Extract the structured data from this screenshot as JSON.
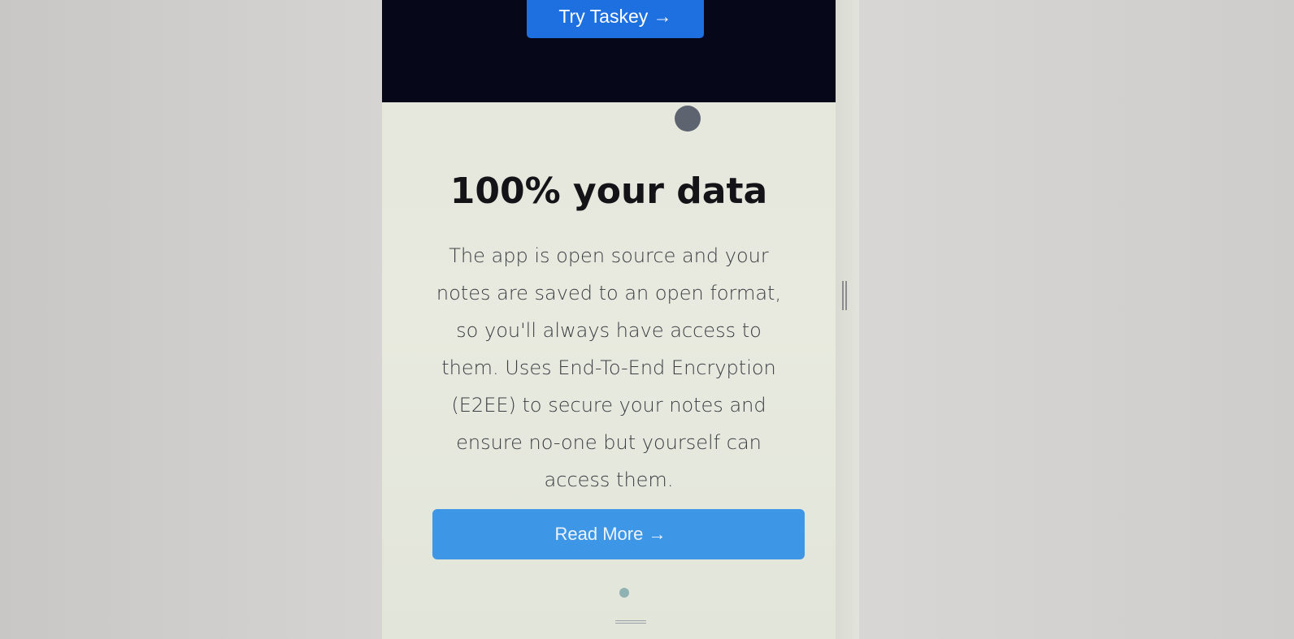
{
  "hero": {
    "cta_label": "Try Taskey →"
  },
  "feature": {
    "title": "100% your data",
    "description": "The app is open source and your notes are saved to an open format, so you'll always have access to them. Uses End-To-End Encryption (E2EE) to secure your notes and ensure no-one but yourself can access them.",
    "read_more_label": "Read More →"
  },
  "colors": {
    "hero_background": "#07071a",
    "primary_button": "#1e6fe0",
    "secondary_button": "#3d97e6",
    "page_background": "#e6e8dd"
  }
}
